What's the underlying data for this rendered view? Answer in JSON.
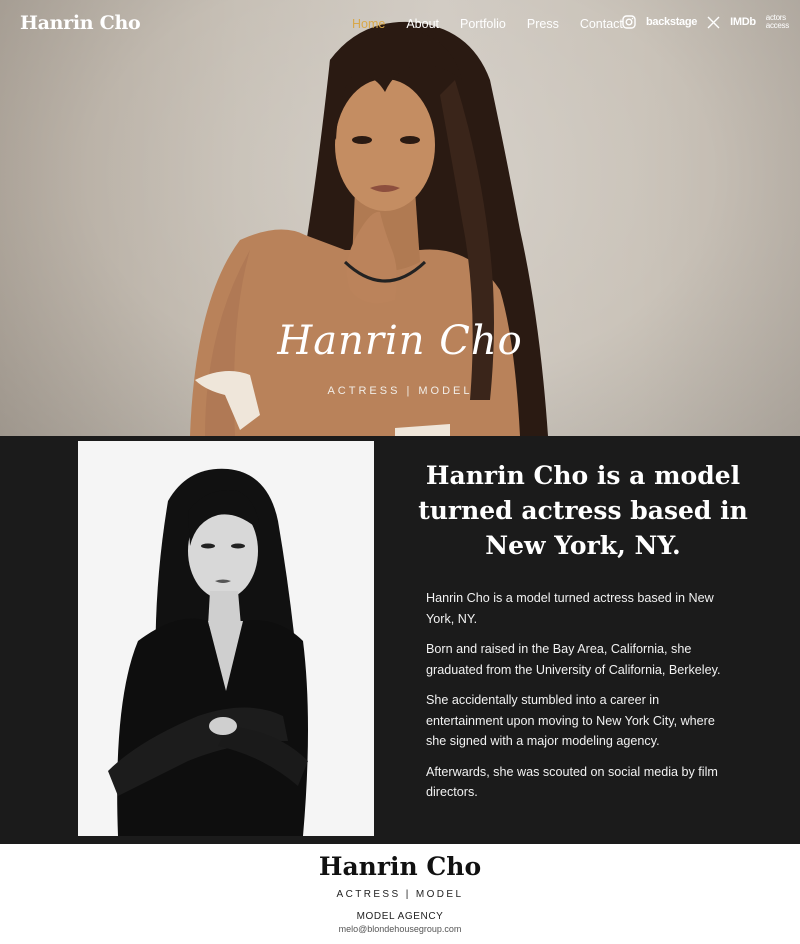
{
  "site": {
    "logo": "Hanrin Cho",
    "nav": [
      {
        "label": "Home",
        "active": true
      },
      {
        "label": "About",
        "active": false
      },
      {
        "label": "Portfolio",
        "active": false
      },
      {
        "label": "Press",
        "active": false
      },
      {
        "label": "Contact",
        "active": false
      }
    ],
    "social": {
      "instagram_icon": "instagram-icon",
      "backstage": "backstage",
      "x_icon": "x-icon",
      "imdb": "IMDb",
      "actors_access_line1": "actors",
      "actors_access_line2": "access"
    },
    "accent_color": "#d8a84a"
  },
  "hero": {
    "signature": "Hanrin Cho",
    "tagline": "ACTRESS | MODEL"
  },
  "about": {
    "heading": "Hanrin Cho is a model turned actress based in New York, NY.",
    "paragraphs": [
      "Hanrin Cho is a model turned actress based in New York, NY.",
      "Born and raised in the Bay Area, California, she graduated from the University of California, Berkeley.",
      "She accidentally stumbled into a career in entertainment upon moving to New York City, where she signed with a major modeling agency.",
      "Afterwards, she was scouted on social media by film directors."
    ]
  },
  "footer": {
    "name": "Hanrin Cho",
    "subtitle": "ACTRESS | MODEL",
    "agency_label": "MODEL AGENCY",
    "email": "melo@blondehousegroup.com"
  }
}
